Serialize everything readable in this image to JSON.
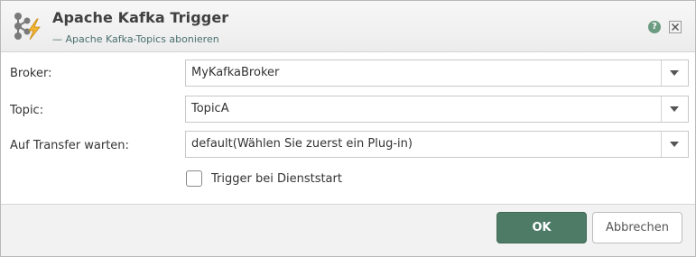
{
  "header": {
    "title": "Apache Kafka Trigger",
    "subtitle": "— Apache Kafka-Topics abonieren",
    "app_icon": "kafka-trigger-icon",
    "help_icon": "help-icon",
    "help_glyph": "?",
    "close_icon": "close-icon"
  },
  "form": {
    "broker": {
      "label": "Broker:",
      "value": "MyKafkaBroker"
    },
    "topic": {
      "label": "Topic:",
      "value": "TopicA"
    },
    "transfer": {
      "label": "Auf Transfer warten:",
      "value": "default(Wählen Sie zuerst ein Plug-in)"
    },
    "trigger_checkbox": {
      "label": "Trigger bei Dienststart",
      "checked": false
    }
  },
  "footer": {
    "ok_label": "OK",
    "cancel_label": "Abbrechen"
  },
  "colors": {
    "primary_button": "#4d7b66",
    "help_icon": "#6b9b80"
  }
}
